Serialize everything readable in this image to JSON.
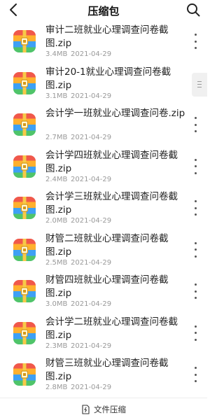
{
  "header": {
    "title": "压缩包",
    "back_icon": "back-arrow-icon",
    "search_icon": "search-icon"
  },
  "files": [
    {
      "name": "审计二班就业心理调查问卷截图.zip",
      "size": "3.4MB",
      "date": "2021-04-29"
    },
    {
      "name": "审计20-1就业心理调查问卷截图.zip",
      "size": "3.1MB",
      "date": "2021-04-29"
    },
    {
      "name": "会计学一班就业心理调查问卷.zip",
      "size": "2.7MB",
      "date": "2021-04-29"
    },
    {
      "name": "会计学四班就业心理调查问卷截图.zip",
      "size": "2.4MB",
      "date": "2021-04-29"
    },
    {
      "name": "会计学三班就业心理调查问卷截图.zip",
      "size": "2.0MB",
      "date": "2021-04-29"
    },
    {
      "name": "财管二班就业心理调查问卷截图.zip",
      "size": "2.5MB",
      "date": "2021-04-29"
    },
    {
      "name": "财管四班就业心理调查问卷截图.zip",
      "size": "3.0MB",
      "date": "2021-04-29"
    },
    {
      "name": "会计学二班就业心理调查问卷截图.zip",
      "size": "2.3MB",
      "date": "2021-04-29"
    },
    {
      "name": "财管三班就业心理调查问卷截图.zip",
      "size": "2.8MB",
      "date": "2021-04-29"
    }
  ],
  "bottom_bar": {
    "label": "文件压缩",
    "icon": "compress-file-icon"
  },
  "colors": {
    "zip_red": "#f0584b",
    "zip_orange": "#ffb02e",
    "zip_blue": "#3ea0f5",
    "zip_green": "#4fc46a",
    "zip_strap": "#f7c948"
  }
}
